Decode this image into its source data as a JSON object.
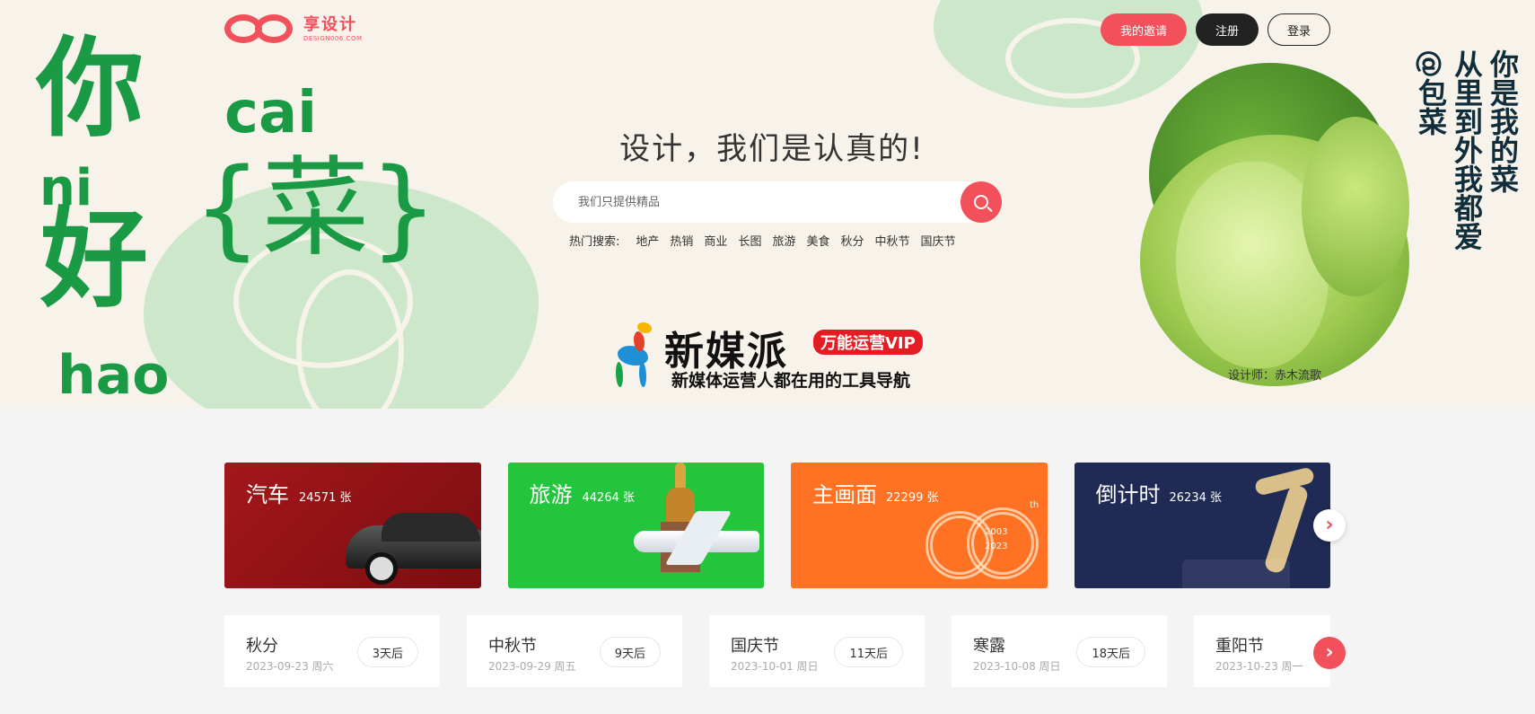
{
  "header": {
    "logo_cn": "享设计",
    "logo_en": "DESIGN006.COM",
    "buttons": {
      "invite": "我的邀请",
      "register": "注册",
      "login": "登录"
    }
  },
  "hero": {
    "art": {
      "ni": "你",
      "hao": "好",
      "cai": "{菜}",
      "pinyin_ni": "ni",
      "pinyin_hao": "hao",
      "pinyin_cai": "cai"
    },
    "slogan": "设计，我们是认真的!",
    "search": {
      "placeholder": "我们只提供精品"
    },
    "hot_label": "热门搜索:",
    "hot_keywords": [
      "地产",
      "热销",
      "商业",
      "长图",
      "旅游",
      "美食",
      "秋分",
      "中秋节",
      "国庆节"
    ],
    "promo": {
      "title": "新媒派",
      "badge": "万能运营VIP",
      "subtitle": "新媒体运营人都在用的工具导航"
    },
    "vertical_lines": [
      "你是我的菜",
      "从里到外我都爱",
      "@包菜"
    ],
    "designer": "设计师：赤木流歌"
  },
  "categories": [
    {
      "name": "汽车",
      "count": "24571 张",
      "color": "#a3171b"
    },
    {
      "name": "旅游",
      "count": "44264 张",
      "color": "#22c53c"
    },
    {
      "name": "主画面",
      "count": "22299 张",
      "color": "#ff7224",
      "badge_years": [
        "2003",
        "2023"
      ],
      "badge_suffix": "th"
    },
    {
      "name": "倒计时",
      "count": "26234 张",
      "color": "#1f2a55"
    }
  ],
  "festivals": [
    {
      "name": "秋分",
      "date": "2023-09-23 周六",
      "days": "3天后"
    },
    {
      "name": "中秋节",
      "date": "2023-09-29 周五",
      "days": "9天后"
    },
    {
      "name": "国庆节",
      "date": "2023-10-01 周日",
      "days": "11天后"
    },
    {
      "name": "寒露",
      "date": "2023-10-08 周日",
      "days": "18天后"
    },
    {
      "name": "重阳节",
      "date": "2023-10-23 周一",
      "days": ""
    }
  ],
  "colors": {
    "accent": "#f2505a",
    "hero_bg": "#f8f3ea",
    "art_green": "#1a9a45"
  }
}
